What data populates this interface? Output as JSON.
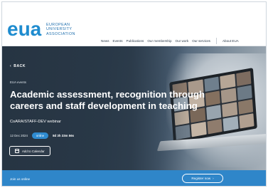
{
  "header": {
    "logo_mark": "eua",
    "logo_lines": [
      "EUROPEAN",
      "UNIVERSITY",
      "ASSOCIATION"
    ],
    "nav": [
      "News",
      "Events",
      "Publications",
      "Our membership",
      "Our work",
      "Our services"
    ],
    "nav_about": "About EUA"
  },
  "hero": {
    "back_label": "BACK",
    "breadcrumb": "EUA events",
    "title": "Academic assessment, recognition through careers and staff development in teaching",
    "subtitle": "CoARA/STAFF-DEV webinar",
    "date": "12 Dec 2024",
    "badge": "online",
    "countdown": "8d 3h 33m 56s",
    "calendar_label": "Add to Calendar"
  },
  "footer_bar": {
    "text": "Join us online",
    "button_label": "Register now"
  },
  "colors": {
    "brand_blue": "#1f8ccf",
    "bar_blue": "#2f86c9",
    "hero_dark": "#2b3a4a"
  }
}
